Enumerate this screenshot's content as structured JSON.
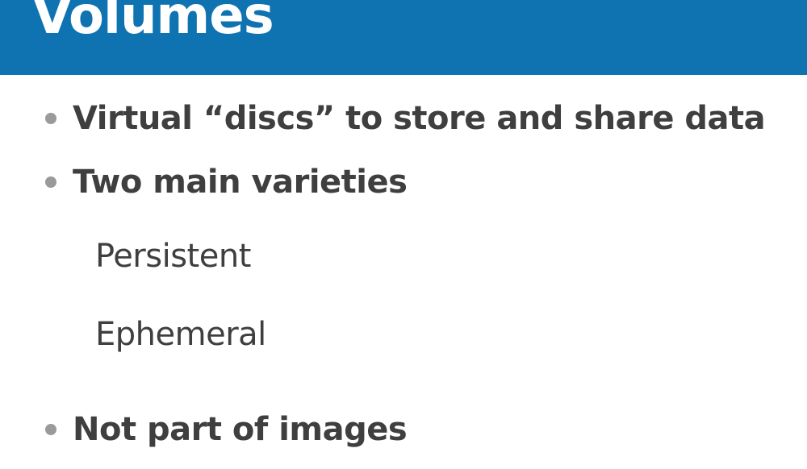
{
  "slide": {
    "title": "Volumes",
    "bullets": [
      {
        "text": "Virtual “discs” to store and share data"
      },
      {
        "text": "Two main varieties"
      },
      {
        "text": "Not part of images"
      }
    ],
    "sub_items": [
      {
        "text": "Persistent"
      },
      {
        "text": "Ephemeral"
      }
    ]
  },
  "colors": {
    "title_bar": "#0f73b1",
    "title_text": "#ffffff",
    "body_text": "#3f3f3f",
    "bullet": "#9a9a9a"
  }
}
